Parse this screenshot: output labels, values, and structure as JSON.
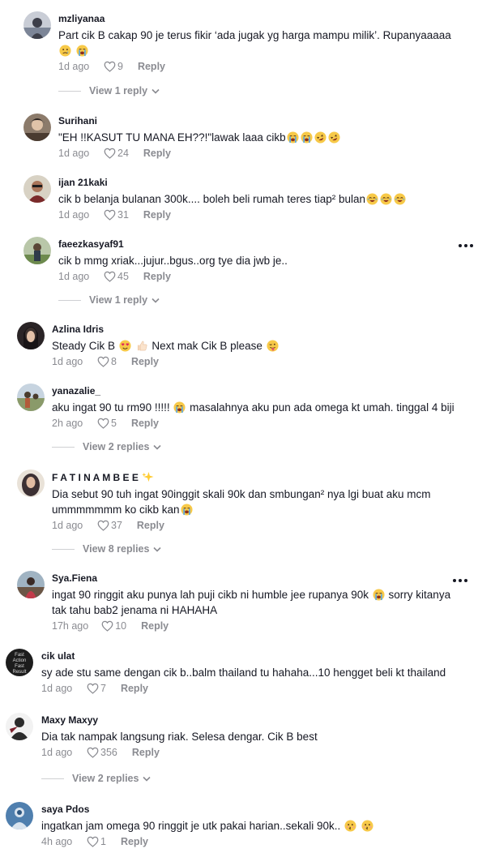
{
  "comments": [
    {
      "username": "mzliyanaa",
      "text": "Part cik B cakap 90 je terus fikir ‘ada jugak yg harga mampu milik’. Rupanyaaaaa",
      "date": "1d ago",
      "likes": "9",
      "reply_label": "Reply",
      "view_replies": "View 1 reply"
    },
    {
      "username": "Surihani",
      "text": "\"EH !!KASUT TU MANA EH??!\"lawak laaa cikb",
      "date": "1d ago",
      "likes": "24",
      "reply_label": "Reply"
    },
    {
      "username": "ijan 21kaki",
      "text": "cik b belanja bulanan 300k.... boleh beli rumah teres tiap² bulan",
      "date": "1d ago",
      "likes": "31",
      "reply_label": "Reply"
    },
    {
      "username": "faeezkasyaf91",
      "text": "cik b mmg xriak...jujur..bgus..org tye dia jwb je..",
      "date": "1d ago",
      "likes": "45",
      "reply_label": "Reply",
      "view_replies": "View 1 reply"
    },
    {
      "username": "Azlina Idris",
      "text_a": "Steady Cik B",
      "text_b": "Next mak Cik B please",
      "date": "1d ago",
      "likes": "8",
      "reply_label": "Reply"
    },
    {
      "username": "yanazalie_",
      "text_a": "aku ingat 90 tu rm90 !!!!!",
      "text_b": "masalahnya aku pun ada omega kt umah. tinggal 4 biji",
      "date": "2h ago",
      "likes": "5",
      "reply_label": "Reply",
      "view_replies": "View 2 replies"
    },
    {
      "username": "F A T I N A M B E E",
      "text": "Dia sebut 90 tuh ingat 90inggit skali 90k dan smbungan² nya lgi buat aku mcm ummmmmmm ko cikb kan",
      "date": "1d ago",
      "likes": "37",
      "reply_label": "Reply",
      "view_replies": "View 8 replies"
    },
    {
      "username": "Sya.Fiena",
      "text_a": "ingat 90 ringgit aku punya lah puji cikb ni humble jee rupanya 90k",
      "text_b": "sorry kitanya tak tahu bab2 jenama ni HAHAHA",
      "date": "17h ago",
      "likes": "10",
      "reply_label": "Reply"
    },
    {
      "username": "cik ulat",
      "text": "sy ade stu same dengan cik b..balm thailand tu hahaha...10 hengget beli kt thailand",
      "date": "1d ago",
      "likes": "7",
      "reply_label": "Reply",
      "avatar_text": [
        "Fast",
        "Action",
        "Fast",
        "Result"
      ]
    },
    {
      "username": "Maxy Maxyy",
      "text": "Dia tak nampak langsung riak. Selesa dengar. Cik B best",
      "date": "1d ago",
      "likes": "356",
      "reply_label": "Reply",
      "view_replies": "View 2 replies"
    },
    {
      "username": "saya Pdos",
      "text": "ingatkan jam omega 90 ringgit je utk pakai harian..sekali 90k..",
      "date": "4h ago",
      "likes": "1",
      "reply_label": "Reply"
    }
  ],
  "icons": {
    "like": "heart-outline-icon",
    "more": "more-options-icon",
    "chevron": "chevron-down-icon"
  },
  "colors": {
    "text": "#161823",
    "meta": "#8a8b91",
    "divider": "#cfd0d3"
  }
}
